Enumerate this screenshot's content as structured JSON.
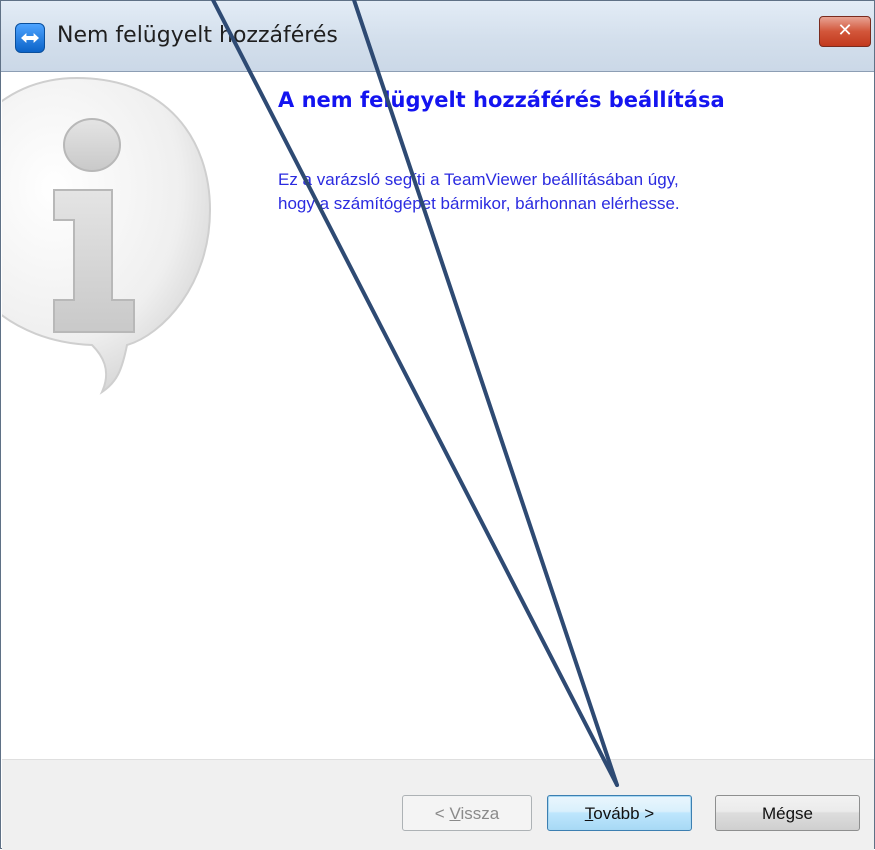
{
  "window": {
    "title": "Nem felügyelt hozzáférés",
    "close_label": "✕"
  },
  "content": {
    "heading": "A nem felügyelt hozzáférés beállítása",
    "description_line1": "Ez a varázsló segíti a TeamViewer beállításában úgy,",
    "description_line2": "hogy a számítógépet bármikor, bárhonnan elérhesse."
  },
  "footer": {
    "back": {
      "prefix": "< ",
      "accel": "V",
      "rest": "issza",
      "enabled": false
    },
    "next": {
      "accel": "T",
      "rest": "ovább >",
      "enabled": true,
      "default": true
    },
    "cancel": {
      "label": "Mégse",
      "enabled": true
    }
  },
  "icons": {
    "app": "teamviewer-icon",
    "watermark": "info-speech-bubble-icon",
    "close": "close-icon"
  },
  "annotation": {
    "color": "#2e4a73",
    "description": "two arrows pointing to Tovább button"
  }
}
